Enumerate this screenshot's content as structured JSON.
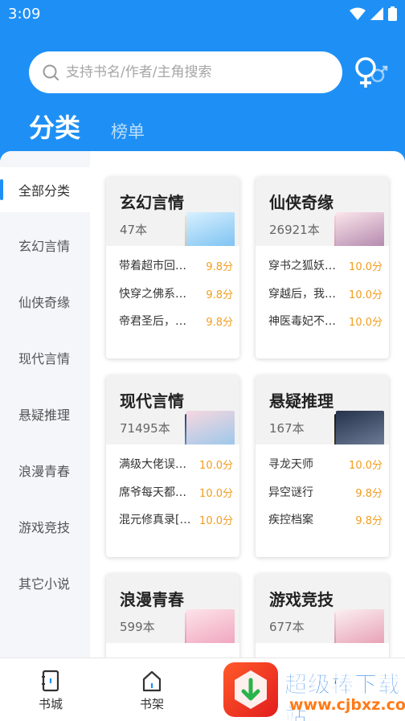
{
  "status": {
    "time": "3:09"
  },
  "search": {
    "placeholder": "支持书名/作者/主角搜索"
  },
  "tabs": {
    "category": "分类",
    "ranking": "榜单"
  },
  "sidebar": {
    "items": [
      {
        "label": "全部分类",
        "active": true
      },
      {
        "label": "玄幻言情"
      },
      {
        "label": "仙侠奇缘"
      },
      {
        "label": "现代言情"
      },
      {
        "label": "悬疑推理"
      },
      {
        "label": "浪漫青春"
      },
      {
        "label": "游戏竞技"
      },
      {
        "label": "其它小说"
      }
    ]
  },
  "cards": [
    {
      "title": "玄幻言情",
      "count": "47本",
      "books": [
        {
          "name": "带着超市回…",
          "score": "9.8分"
        },
        {
          "name": "快穿之佛系…",
          "score": "9.8分"
        },
        {
          "name": "帝君圣后，…",
          "score": "9.8分"
        }
      ]
    },
    {
      "title": "仙侠奇缘",
      "count": "26921本",
      "books": [
        {
          "name": "穿书之狐妖…",
          "score": "10.0分"
        },
        {
          "name": "穿越后，我…",
          "score": "10.0分"
        },
        {
          "name": "神医毒妃不…",
          "score": "10.0分"
        }
      ]
    },
    {
      "title": "现代言情",
      "count": "71495本",
      "books": [
        {
          "name": "满级大佬误…",
          "score": "10.0分"
        },
        {
          "name": "席爷每天都…",
          "score": "10.0分"
        },
        {
          "name": "混元修真录[…",
          "score": "10.0分"
        }
      ]
    },
    {
      "title": "悬疑推理",
      "count": "167本",
      "books": [
        {
          "name": "寻龙天师",
          "score": "10.0分"
        },
        {
          "name": "异空谜行",
          "score": "9.8分"
        },
        {
          "name": "疾控档案",
          "score": "9.8分"
        }
      ]
    },
    {
      "title": "浪漫青春",
      "count": "599本",
      "books": []
    },
    {
      "title": "游戏竞技",
      "count": "677本",
      "books": []
    }
  ],
  "nav": {
    "bookstore": "书城",
    "bookshelf": "书架"
  },
  "watermark": {
    "text": "超级棒下载站",
    "url": "www.cjbxz.com"
  },
  "colors": {
    "brand": "#1e90f5",
    "score": "#f29d1e"
  }
}
